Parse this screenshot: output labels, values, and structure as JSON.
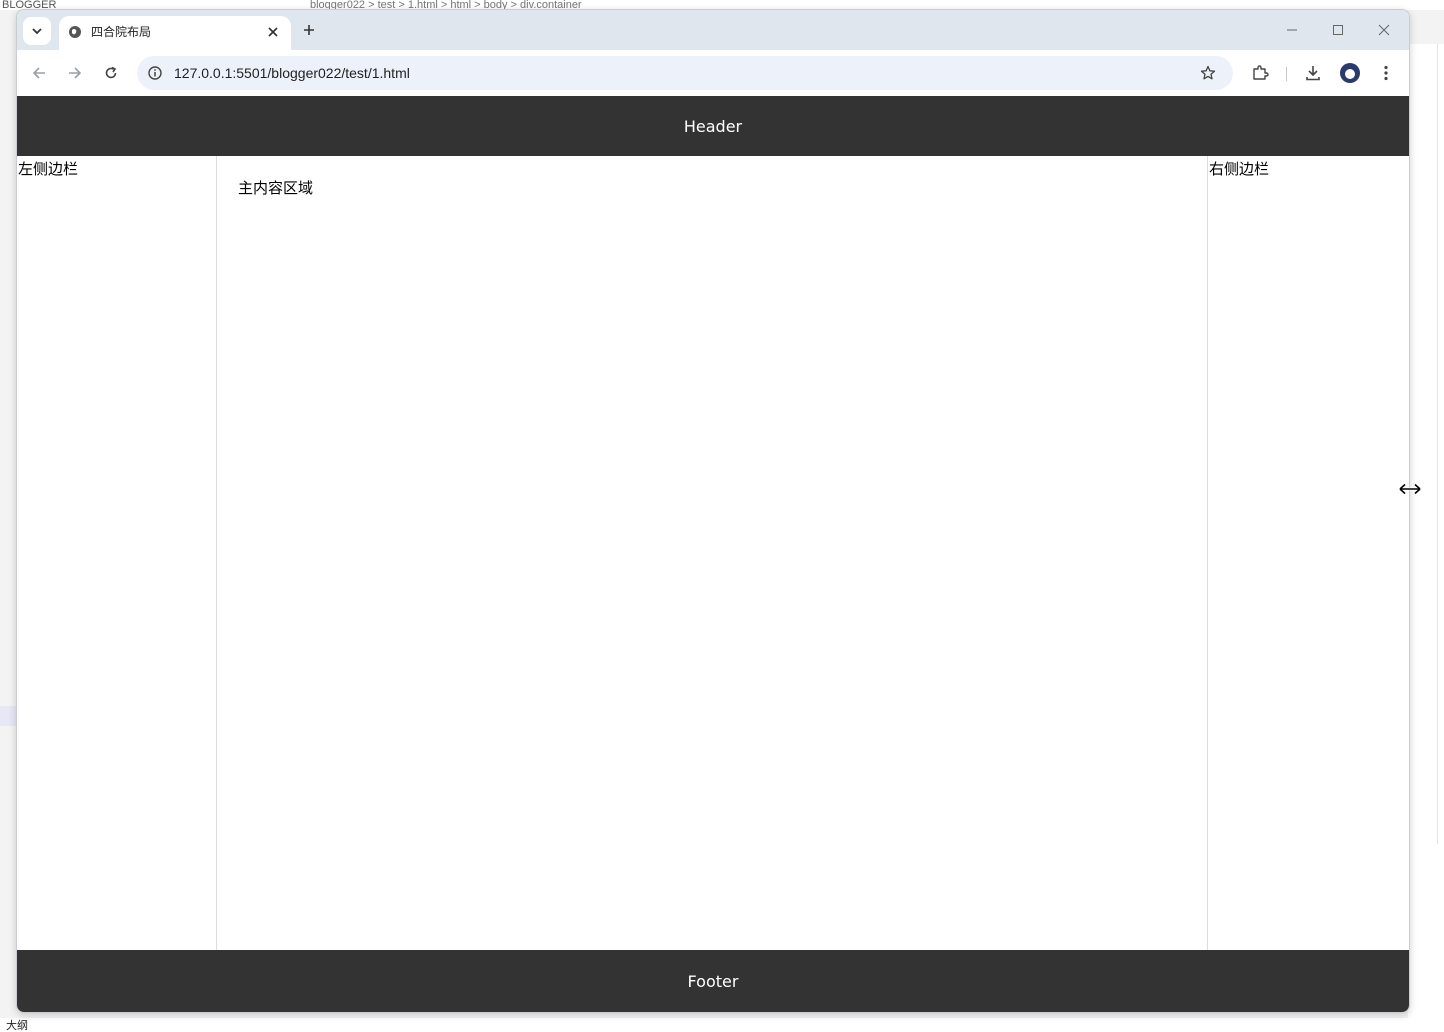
{
  "background": {
    "explorer_label": "BLOGGER",
    "breadcrumb": "blogger022 > test > 1.html > html > body > div.container",
    "outline_label": "大纲"
  },
  "browser": {
    "tab": {
      "title": "四合院布局",
      "close_icon": "close-icon",
      "favicon": "globe-icon"
    },
    "tab_search_icon": "chevron-down-icon",
    "new_tab_icon": "plus-icon",
    "window_controls": {
      "minimize": "minimize-icon",
      "maximize": "maximize-icon",
      "close": "close-icon"
    },
    "toolbar": {
      "url": "127.0.0.1:5501/blogger022/test/1.html"
    }
  },
  "page": {
    "header": "Header",
    "left_sidebar": "左侧边栏",
    "main": "主内容区域",
    "right_sidebar": "右侧边栏",
    "footer": "Footer"
  },
  "colors": {
    "header_bg": "#333333",
    "footer_bg": "#333333",
    "tabstrip_bg": "#dfe6ee",
    "omnibox_bg": "#edf2fa"
  }
}
